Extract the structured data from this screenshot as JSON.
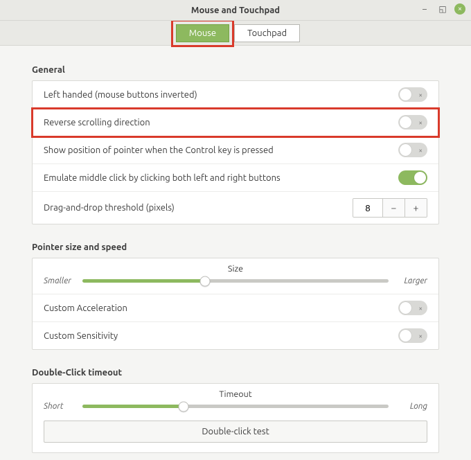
{
  "window": {
    "title": "Mouse and Touchpad"
  },
  "tabs": {
    "mouse": "Mouse",
    "touchpad": "Touchpad"
  },
  "sections": {
    "general": "General",
    "pointer": "Pointer size and speed",
    "double_click": "Double-Click timeout"
  },
  "general": {
    "left_handed": "Left handed (mouse buttons inverted)",
    "reverse_scroll": "Reverse scrolling direction",
    "show_pointer_ctrl": "Show position of pointer when the Control key is pressed",
    "emulate_middle": "Emulate middle click by clicking both left and right buttons",
    "drag_threshold_label": "Drag-and-drop threshold (pixels)",
    "drag_threshold_value": "8"
  },
  "pointer": {
    "size_label": "Size",
    "smaller": "Smaller",
    "larger": "Larger",
    "size_percent": 40,
    "custom_accel": "Custom Acceleration",
    "custom_sens": "Custom Sensitivity"
  },
  "double_click": {
    "timeout_label": "Timeout",
    "short": "Short",
    "long": "Long",
    "timeout_percent": 33,
    "test_label": "Double-click test"
  },
  "icons": {
    "minimize": "–",
    "maximize": "◱",
    "close": "×",
    "toggle_off": "×",
    "minus": "−",
    "plus": "+"
  }
}
